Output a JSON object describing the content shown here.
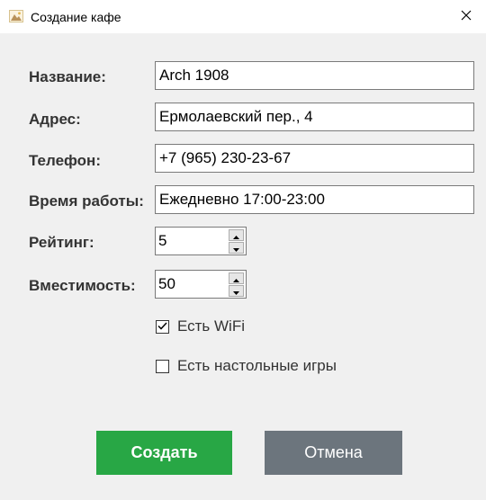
{
  "window": {
    "title": "Создание кафе"
  },
  "form": {
    "name": {
      "label": "Название:",
      "value": "Arch 1908"
    },
    "address": {
      "label": "Адрес:",
      "value": "Ермолаевский пер., 4"
    },
    "phone": {
      "label": "Телефон:",
      "value": "+7 (965) 230-23-67"
    },
    "hours": {
      "label": "Время работы:",
      "value": "Ежедневно 17:00-23:00"
    },
    "rating": {
      "label": "Рейтинг:",
      "value": "5"
    },
    "capacity": {
      "label": "Вместимость:",
      "value": "50"
    },
    "wifi": {
      "label": "Есть WiFi",
      "checked": true
    },
    "board_games": {
      "label": "Есть настольные игры",
      "checked": false
    }
  },
  "buttons": {
    "create": "Создать",
    "cancel": "Отмена"
  },
  "colors": {
    "create": "#28a745",
    "cancel": "#6c757d"
  },
  "icons": {
    "app": "image-icon",
    "close": "close-icon",
    "spin_up": "chevron-up-icon",
    "spin_down": "chevron-down-icon",
    "check": "checkmark-icon"
  }
}
